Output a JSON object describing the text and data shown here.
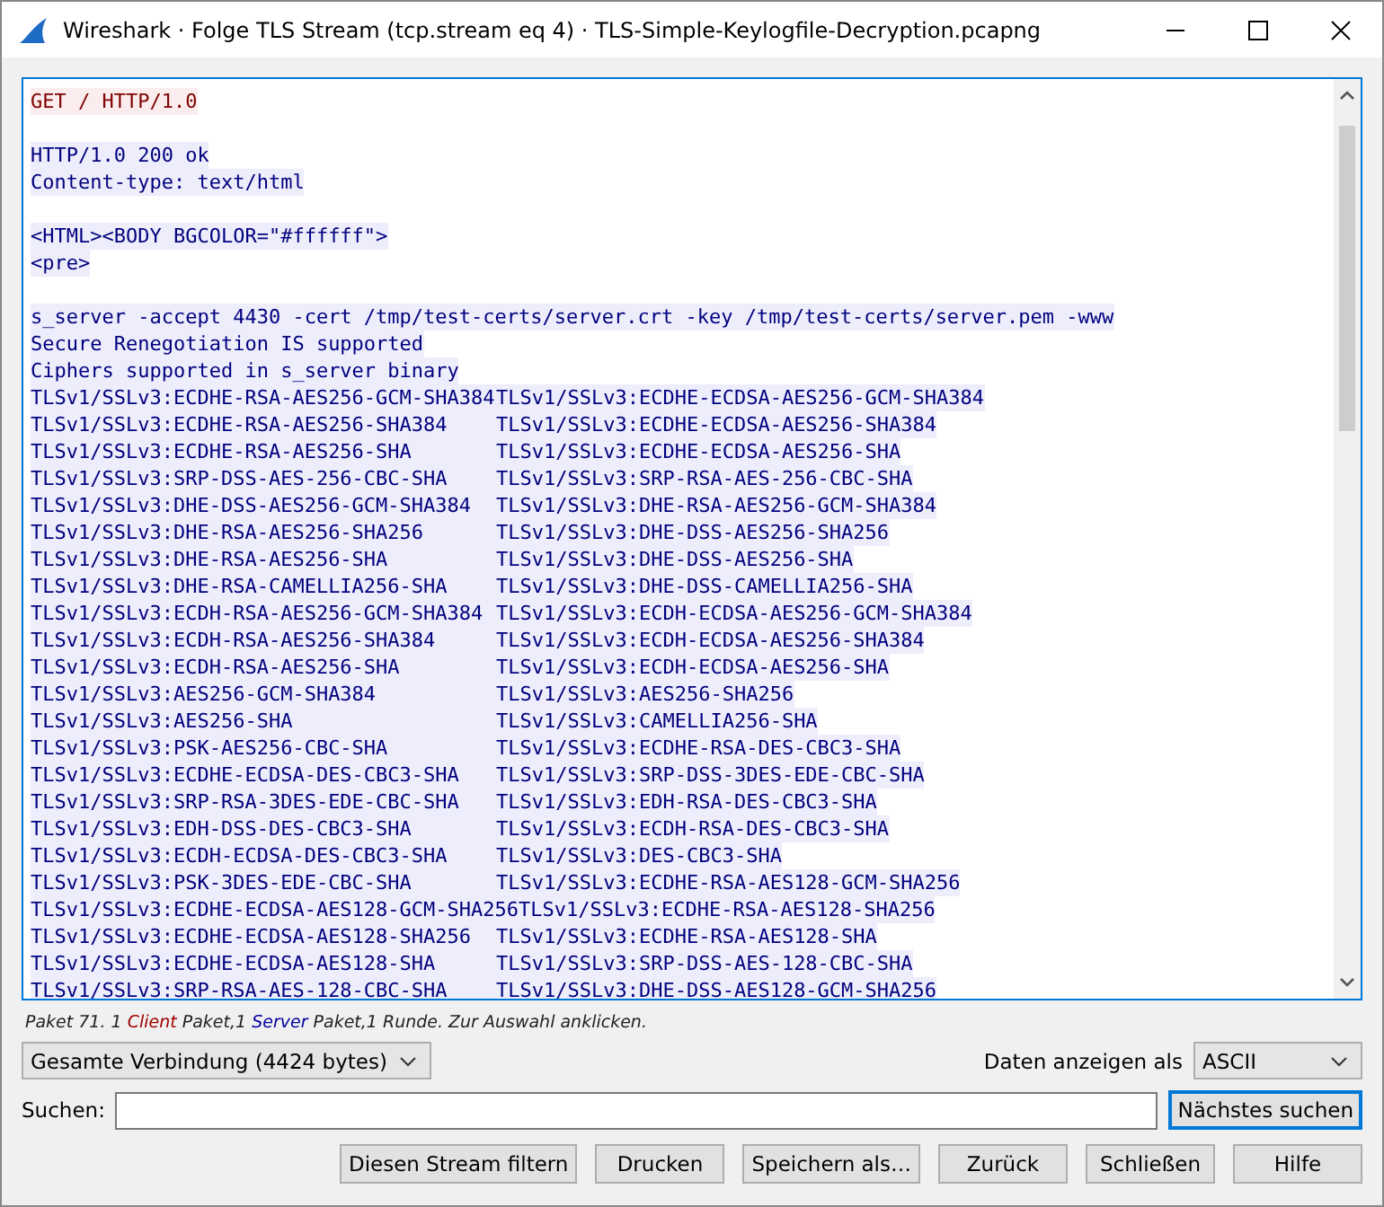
{
  "window": {
    "title": "Wireshark · Folge TLS Stream (tcp.stream eq 4) · TLS-Simple-Keylogfile-Decryption.pcapng"
  },
  "stream": [
    {
      "from_client": true,
      "lines": [
        {
          "text": "GET / HTTP/1.0"
        }
      ]
    },
    {
      "from_client": false,
      "lines": [
        {
          "text": "HTTP/1.0 200 ok"
        },
        {
          "text": "Content-type: text/html"
        }
      ]
    },
    {
      "from_client": false,
      "lines": [
        {
          "text": "<HTML><BODY BGCOLOR=\"#ffffff\">"
        },
        {
          "text": "<pre>"
        }
      ]
    },
    {
      "from_client": false,
      "lines": [
        {
          "text": "s_server -accept 4430 -cert /tmp/test-certs/server.crt -key /tmp/test-certs/server.pem -www"
        },
        {
          "text": "Secure Renegotiation IS supported"
        },
        {
          "text": "Ciphers supported in s_server binary"
        },
        {
          "cells": [
            "TLSv1/SSLv3:ECDHE-RSA-AES256-GCM-SHA384",
            "TLSv1/SSLv3:ECDHE-ECDSA-AES256-GCM-SHA384"
          ]
        },
        {
          "cells": [
            "TLSv1/SSLv3:ECDHE-RSA-AES256-SHA384",
            "TLSv1/SSLv3:ECDHE-ECDSA-AES256-SHA384"
          ]
        },
        {
          "cells": [
            "TLSv1/SSLv3:ECDHE-RSA-AES256-SHA",
            "TLSv1/SSLv3:ECDHE-ECDSA-AES256-SHA"
          ]
        },
        {
          "cells": [
            "TLSv1/SSLv3:SRP-DSS-AES-256-CBC-SHA",
            "TLSv1/SSLv3:SRP-RSA-AES-256-CBC-SHA"
          ]
        },
        {
          "cells": [
            "TLSv1/SSLv3:DHE-DSS-AES256-GCM-SHA384",
            "TLSv1/SSLv3:DHE-RSA-AES256-GCM-SHA384"
          ]
        },
        {
          "cells": [
            "TLSv1/SSLv3:DHE-RSA-AES256-SHA256",
            "TLSv1/SSLv3:DHE-DSS-AES256-SHA256"
          ]
        },
        {
          "cells": [
            "TLSv1/SSLv3:DHE-RSA-AES256-SHA",
            "TLSv1/SSLv3:DHE-DSS-AES256-SHA"
          ]
        },
        {
          "cells": [
            "TLSv1/SSLv3:DHE-RSA-CAMELLIA256-SHA",
            "TLSv1/SSLv3:DHE-DSS-CAMELLIA256-SHA"
          ]
        },
        {
          "cells": [
            "TLSv1/SSLv3:ECDH-RSA-AES256-GCM-SHA384",
            "TLSv1/SSLv3:ECDH-ECDSA-AES256-GCM-SHA384"
          ]
        },
        {
          "cells": [
            "TLSv1/SSLv3:ECDH-RSA-AES256-SHA384",
            "TLSv1/SSLv3:ECDH-ECDSA-AES256-SHA384"
          ]
        },
        {
          "cells": [
            "TLSv1/SSLv3:ECDH-RSA-AES256-SHA",
            "TLSv1/SSLv3:ECDH-ECDSA-AES256-SHA"
          ]
        },
        {
          "cells": [
            "TLSv1/SSLv3:AES256-GCM-SHA384",
            "TLSv1/SSLv3:AES256-SHA256"
          ]
        },
        {
          "cells": [
            "TLSv1/SSLv3:AES256-SHA",
            "TLSv1/SSLv3:CAMELLIA256-SHA"
          ]
        },
        {
          "cells": [
            "TLSv1/SSLv3:PSK-AES256-CBC-SHA",
            "TLSv1/SSLv3:ECDHE-RSA-DES-CBC3-SHA"
          ]
        },
        {
          "cells": [
            "TLSv1/SSLv3:ECDHE-ECDSA-DES-CBC3-SHA",
            "TLSv1/SSLv3:SRP-DSS-3DES-EDE-CBC-SHA"
          ]
        },
        {
          "cells": [
            "TLSv1/SSLv3:SRP-RSA-3DES-EDE-CBC-SHA",
            "TLSv1/SSLv3:EDH-RSA-DES-CBC3-SHA"
          ]
        },
        {
          "cells": [
            "TLSv1/SSLv3:EDH-DSS-DES-CBC3-SHA",
            "TLSv1/SSLv3:ECDH-RSA-DES-CBC3-SHA"
          ]
        },
        {
          "cells": [
            "TLSv1/SSLv3:ECDH-ECDSA-DES-CBC3-SHA",
            "TLSv1/SSLv3:DES-CBC3-SHA"
          ]
        },
        {
          "cells": [
            "TLSv1/SSLv3:PSK-3DES-EDE-CBC-SHA",
            "TLSv1/SSLv3:ECDHE-RSA-AES128-GCM-SHA256"
          ]
        },
        {
          "cells": [
            "TLSv1/SSLv3:ECDHE-ECDSA-AES128-GCM-SHA256",
            "TLSv1/SSLv3:ECDHE-RSA-AES128-SHA256"
          ]
        },
        {
          "cells": [
            "TLSv1/SSLv3:ECDHE-ECDSA-AES128-SHA256",
            "TLSv1/SSLv3:ECDHE-RSA-AES128-SHA"
          ]
        },
        {
          "cells": [
            "TLSv1/SSLv3:ECDHE-ECDSA-AES128-SHA",
            "TLSv1/SSLv3:SRP-DSS-AES-128-CBC-SHA"
          ]
        },
        {
          "cells": [
            "TLSv1/SSLv3:SRP-RSA-AES-128-CBC-SHA",
            "TLSv1/SSLv3:DHE-DSS-AES128-GCM-SHA256"
          ]
        }
      ]
    }
  ],
  "status": {
    "prefix": "Paket 71. 1",
    "client_label": "Client",
    "middle": "Paket,1",
    "server_label": "Server",
    "suffix": "Paket,1 Runde. Zur Auswahl anklicken."
  },
  "conversation_select": {
    "value": "Gesamte Verbindung (4424 bytes)"
  },
  "show_as": {
    "label": "Daten anzeigen als",
    "value": "ASCII"
  },
  "search": {
    "label": "Suchen:",
    "button": "Nächstes suchen"
  },
  "buttons": [
    "Diesen Stream filtern",
    "Drucken",
    "Speichern als…",
    "Zurück",
    "Schließen",
    "Hilfe"
  ]
}
